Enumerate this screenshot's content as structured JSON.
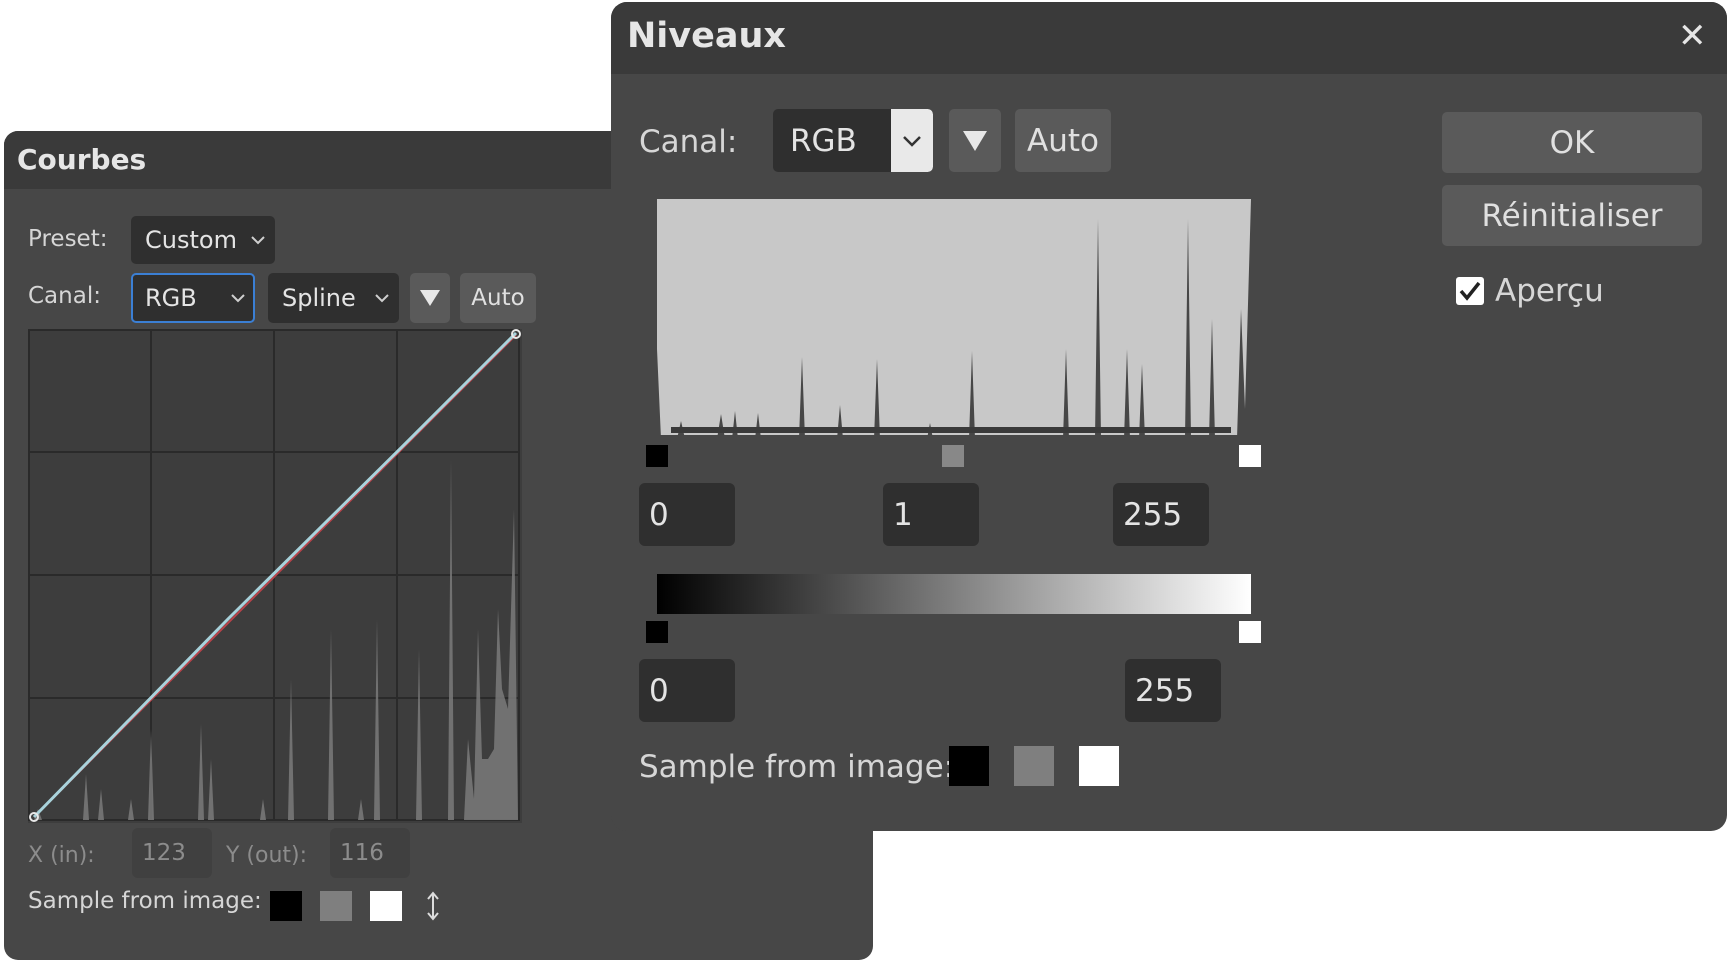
{
  "curves": {
    "title": "Courbes",
    "preset_label": "Preset:",
    "preset_value": "Custom",
    "channel_label": "Canal:",
    "channel_value": "RGB",
    "interp_value": "Spline",
    "auto_label": "Auto",
    "x_label": "X (in):",
    "x_value": "123",
    "y_label": "Y (out):",
    "y_value": "116",
    "sample_label": "Sample from image:"
  },
  "levels": {
    "title": "Niveaux",
    "close_glyph": "✕",
    "channel_label": "Canal:",
    "channel_value": "RGB",
    "auto_label": "Auto",
    "ok_label": "OK",
    "reset_label": "Réinitialiser",
    "preview_label": "Aperçu",
    "preview_checked": true,
    "input_black": "0",
    "input_gamma": "1",
    "input_white": "255",
    "output_black": "0",
    "output_white": "255",
    "sample_label": "Sample from image:"
  },
  "colors": {
    "panel": "#474747",
    "titlebar": "#3a3a3a",
    "field": "#2f2f2f",
    "button": "#5a5a5a",
    "histogram": "#c8c8c8",
    "curve_line": "#a9d3dc",
    "baseline": "#b8434a",
    "focus_border": "#3b7fd4"
  }
}
